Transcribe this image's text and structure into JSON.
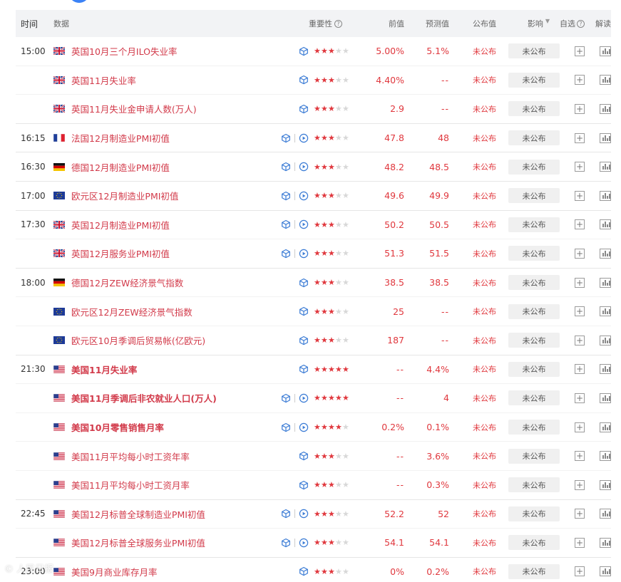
{
  "header": {
    "time": "时间",
    "data": "数据",
    "importance": "重要性",
    "previous": "前值",
    "forecast": "预测值",
    "published": "公布值",
    "impact": "影响",
    "watchlist": "自选",
    "interpret": "解读"
  },
  "colors": {
    "accent_red": "#e0383e",
    "name_red": "#d23a4a",
    "icon_blue": "#3a7bd5"
  },
  "rows": [
    {
      "time": "15:00",
      "flag": "uk",
      "name": "英国10月三个月ILO失业率",
      "bold": false,
      "video": false,
      "stars": 3,
      "previous": "5.00%",
      "forecast": "5.1%",
      "published": "未公布",
      "impact": "未公布"
    },
    {
      "time": "",
      "flag": "uk",
      "name": "英国11月失业率",
      "bold": false,
      "video": false,
      "stars": 3,
      "previous": "4.40%",
      "forecast": "--",
      "published": "未公布",
      "impact": "未公布"
    },
    {
      "time": "",
      "flag": "uk",
      "name": "英国11月失业金申请人数(万人)",
      "bold": false,
      "video": false,
      "stars": 3,
      "previous": "2.9",
      "forecast": "--",
      "published": "未公布",
      "impact": "未公布"
    },
    {
      "time": "16:15",
      "flag": "fr",
      "name": "法国12月制造业PMI初值",
      "bold": false,
      "video": true,
      "stars": 3,
      "previous": "47.8",
      "forecast": "48",
      "published": "未公布",
      "impact": "未公布"
    },
    {
      "time": "16:30",
      "flag": "de",
      "name": "德国12月制造业PMI初值",
      "bold": false,
      "video": true,
      "stars": 3,
      "previous": "48.2",
      "forecast": "48.5",
      "published": "未公布",
      "impact": "未公布"
    },
    {
      "time": "17:00",
      "flag": "eu",
      "name": "欧元区12月制造业PMI初值",
      "bold": false,
      "video": true,
      "stars": 3,
      "previous": "49.6",
      "forecast": "49.9",
      "published": "未公布",
      "impact": "未公布"
    },
    {
      "time": "17:30",
      "flag": "uk",
      "name": "英国12月制造业PMI初值",
      "bold": false,
      "video": true,
      "stars": 3,
      "previous": "50.2",
      "forecast": "50.5",
      "published": "未公布",
      "impact": "未公布"
    },
    {
      "time": "",
      "flag": "uk",
      "name": "英国12月服务业PMI初值",
      "bold": false,
      "video": true,
      "stars": 3,
      "previous": "51.3",
      "forecast": "51.5",
      "published": "未公布",
      "impact": "未公布"
    },
    {
      "time": "18:00",
      "flag": "de",
      "name": "德国12月ZEW经济景气指数",
      "bold": false,
      "video": false,
      "stars": 3,
      "previous": "38.5",
      "forecast": "38.5",
      "published": "未公布",
      "impact": "未公布"
    },
    {
      "time": "",
      "flag": "eu",
      "name": "欧元区12月ZEW经济景气指数",
      "bold": false,
      "video": false,
      "stars": 3,
      "previous": "25",
      "forecast": "--",
      "published": "未公布",
      "impact": "未公布"
    },
    {
      "time": "",
      "flag": "eu",
      "name": "欧元区10月季调后贸易帐(亿欧元)",
      "bold": false,
      "video": false,
      "stars": 3,
      "previous": "187",
      "forecast": "--",
      "published": "未公布",
      "impact": "未公布"
    },
    {
      "time": "21:30",
      "flag": "us",
      "name": "美国11月失业率",
      "bold": true,
      "video": false,
      "stars": 5,
      "previous": "--",
      "forecast": "4.4%",
      "published": "未公布",
      "impact": "未公布"
    },
    {
      "time": "",
      "flag": "us",
      "name": "美国11月季调后非农就业人口(万人)",
      "bold": true,
      "video": true,
      "stars": 5,
      "previous": "--",
      "forecast": "4",
      "published": "未公布",
      "impact": "未公布"
    },
    {
      "time": "",
      "flag": "us",
      "name": "美国10月零售销售月率",
      "bold": true,
      "video": true,
      "stars": 4,
      "previous": "0.2%",
      "forecast": "0.1%",
      "published": "未公布",
      "impact": "未公布"
    },
    {
      "time": "",
      "flag": "us",
      "name": "美国11月平均每小时工资年率",
      "bold": false,
      "video": false,
      "stars": 3,
      "previous": "--",
      "forecast": "3.6%",
      "published": "未公布",
      "impact": "未公布"
    },
    {
      "time": "",
      "flag": "us",
      "name": "美国11月平均每小时工资月率",
      "bold": false,
      "video": false,
      "stars": 3,
      "previous": "--",
      "forecast": "0.3%",
      "published": "未公布",
      "impact": "未公布"
    },
    {
      "time": "22:45",
      "flag": "us",
      "name": "美国12月标普全球制造业PMI初值",
      "bold": false,
      "video": true,
      "stars": 3,
      "previous": "52.2",
      "forecast": "52",
      "published": "未公布",
      "impact": "未公布"
    },
    {
      "time": "",
      "flag": "us",
      "name": "美国12月标普全球服务业PMI初值",
      "bold": false,
      "video": true,
      "stars": 3,
      "previous": "54.1",
      "forecast": "54.1",
      "published": "未公布",
      "impact": "未公布"
    },
    {
      "time": "23:00",
      "flag": "us",
      "name": "美国9月商业库存月率",
      "bold": false,
      "video": false,
      "stars": 3,
      "previous": "0%",
      "forecast": "0.2%",
      "published": "未公布",
      "impact": "未公布"
    }
  ]
}
